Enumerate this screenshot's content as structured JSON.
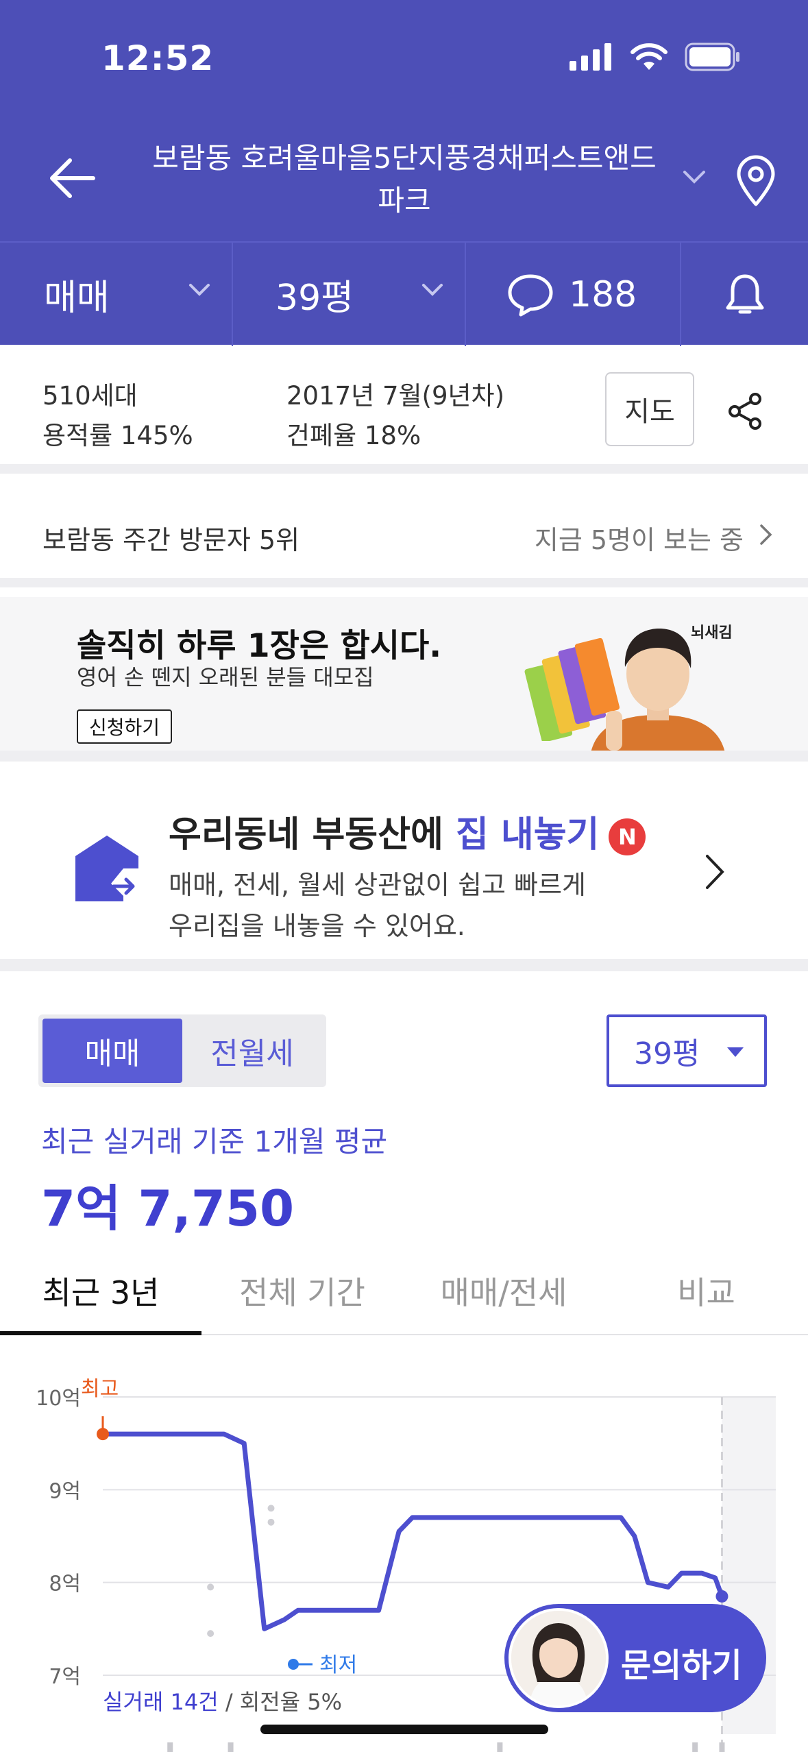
{
  "status_bar": {
    "time": "12:52"
  },
  "header": {
    "title_line1": "보람동 호려울마을5단지풍경채퍼스트앤드",
    "title_line2": "파크"
  },
  "tabs": {
    "trade": "매매",
    "size": "39평",
    "comments": "188"
  },
  "info": {
    "households": "510세대",
    "floor_area_ratio": "용적률 145%",
    "built": "2017년 7월(9년차)",
    "coverage_ratio": "건폐율 18%",
    "map_button": "지도"
  },
  "visitors": {
    "rank": "보람동 주간 방문자 5위",
    "viewing_now": "지금 5명이 보는 중"
  },
  "ad_banner": {
    "title": "솔직히 하루 1장은 합시다.",
    "subtitle": "영어 손 뗀지 오래된 분들 대모집",
    "button": "신청하기",
    "brand": "뇌새김"
  },
  "sell_promo": {
    "title_prefix": "우리동네 부동산에 ",
    "title_highlight": "집 내놓기",
    "badge": "N",
    "desc_line1": "매매, 전세, 월세 상관없이 쉽고 빠르게",
    "desc_line2": "우리집을 내놓을 수 있어요."
  },
  "price_section": {
    "segment_active": "매매",
    "segment_other": "전월세",
    "size_select": "39평",
    "avg_label": "최근 실거래 기준 1개월 평균",
    "avg_value": "7억 7,750"
  },
  "period_tabs": {
    "recent3": "최근 3년",
    "all": "전체 기간",
    "trade_jeonse": "매매/전세",
    "compare": "비교"
  },
  "chart_data": {
    "type": "line",
    "yticks": [
      "10억",
      "9억",
      "8억",
      "7억"
    ],
    "ylim": [
      7,
      10
    ],
    "grid": true,
    "marker_high": "최고",
    "marker_low": "최저",
    "series": [
      {
        "points": [
          [
            0.0,
            9.6
          ],
          [
            0.18,
            9.6
          ],
          [
            0.21,
            9.5
          ],
          [
            0.24,
            7.5
          ],
          [
            0.27,
            7.6
          ],
          [
            0.29,
            7.7
          ],
          [
            0.41,
            7.7
          ],
          [
            0.44,
            8.55
          ],
          [
            0.46,
            8.7
          ],
          [
            0.58,
            8.7
          ],
          [
            0.77,
            8.7
          ],
          [
            0.79,
            8.5
          ],
          [
            0.81,
            8.0
          ],
          [
            0.84,
            7.95
          ],
          [
            0.86,
            8.1
          ],
          [
            0.89,
            8.1
          ],
          [
            0.91,
            8.05
          ],
          [
            0.92,
            7.85
          ]
        ]
      }
    ]
  },
  "stats": {
    "deals": "실거래 14건",
    "turnover": "/ 회전율 5%"
  },
  "inquiry": {
    "label": "문의하기"
  }
}
